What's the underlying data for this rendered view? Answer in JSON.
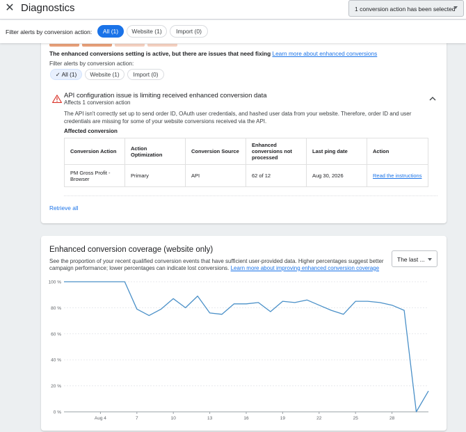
{
  "header": {
    "title": "Diagnostics",
    "selected_label": "1 conversion action has been selected"
  },
  "filter": {
    "label": "Filter alerts by conversion action:",
    "chips": [
      "All (1)",
      "Website (1)",
      "Import (0)"
    ]
  },
  "alerts": {
    "tab_colors": [
      "#e8a07a",
      "#e8a07a",
      "#f6d2c2",
      "#f6d2c2"
    ],
    "warning_text": "The enhanced conversions setting is active, but there are issues that need fixing",
    "warning_link": "Learn more about enhanced conversions",
    "filter_label": "Filter alerts by conversion action:",
    "chips": [
      "All (1)",
      "Website (1)",
      "Import (0)"
    ],
    "issue": {
      "title": "API configuration issue is limiting received enhanced conversion data",
      "subtitle": "Affects 1 conversion action",
      "description": "The API isn't correctly set up to send order ID, OAuth user credentials, and hashed user data from your website. Therefore, order ID and user credentials are missing for some of your website conversions received via the API.",
      "affected_label": "Affected conversion",
      "table": {
        "headers": [
          "Conversion Action",
          "Action Optimization",
          "Conversion Source",
          "Enhanced conversions not processed",
          "Last ping date",
          "Action"
        ],
        "rows": [
          [
            "PM Gross Profit - Browser",
            "Primary",
            "API",
            "62 of 12",
            "Aug 30, 2026",
            "Read the instructions"
          ]
        ]
      }
    },
    "retrieve_label": "Retrieve all"
  },
  "coverage": {
    "title": "Enhanced conversion coverage (website only)",
    "description": "See the proportion of your recent qualified conversion events that have sufficient user-provided data. Higher percentages suggest better campaign performance; lower percentages can indicate lost conversions.",
    "link": "Learn more about improving enhanced conversion coverage",
    "range_label": "The last ...",
    "line_color": "#4a90c8"
  },
  "chart_data": {
    "type": "line",
    "title": "",
    "xlabel": "",
    "ylabel": "",
    "ylim": [
      0,
      100
    ],
    "y_ticks": [
      "0 %",
      "20 %",
      "40 %",
      "60 %",
      "80 %",
      "100 %"
    ],
    "x_tick_labels": [
      {
        "day": 4,
        "label": "Aug 4"
      },
      {
        "day": 7,
        "label": "7"
      },
      {
        "day": 10,
        "label": "10"
      },
      {
        "day": 13,
        "label": "13"
      },
      {
        "day": 16,
        "label": "16"
      },
      {
        "day": 19,
        "label": "19"
      },
      {
        "day": 22,
        "label": "22"
      },
      {
        "day": 25,
        "label": "25"
      },
      {
        "day": 28,
        "label": "28"
      }
    ],
    "grid": true,
    "x": [
      1,
      2,
      3,
      4,
      5,
      6,
      7,
      8,
      9,
      10,
      11,
      12,
      13,
      14,
      15,
      16,
      17,
      18,
      19,
      20,
      21,
      22,
      23,
      24,
      25,
      26,
      27,
      28,
      29,
      30
    ],
    "values": [
      100,
      100,
      100,
      100,
      100,
      100,
      79,
      74,
      79,
      87,
      80,
      89,
      76,
      75,
      83,
      83,
      84,
      77,
      85,
      84,
      86,
      82,
      78,
      75,
      85,
      85,
      84,
      82,
      78,
      0,
      16
    ],
    "value_days": [
      1,
      2,
      3,
      4,
      5,
      6,
      7,
      8,
      9,
      10,
      11,
      12,
      13,
      14,
      15,
      16,
      17,
      18,
      19,
      20,
      21,
      22,
      23,
      24,
      25,
      26,
      27,
      28,
      29,
      30,
      31
    ]
  }
}
